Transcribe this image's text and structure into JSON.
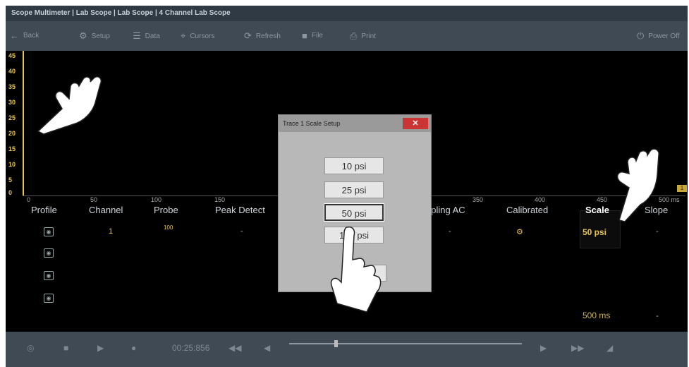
{
  "window": {
    "title": "Scope Multimeter | Lab Scope | Lab Scope | 4 Channel Lab Scope"
  },
  "toolbar": {
    "back": "Back",
    "setup": "Setup",
    "data": "Data",
    "cursors": "Cursors",
    "refresh": "Refresh",
    "file": "File",
    "print": "Print",
    "power_off": "Power Off"
  },
  "plot": {
    "y_ticks": [
      "45",
      "40",
      "35",
      "30",
      "25",
      "20",
      "15",
      "10",
      "5",
      "0"
    ],
    "x_ticks": [
      "0",
      "50",
      "100",
      "150",
      "350",
      "400",
      "450",
      "500 ms"
    ],
    "trace_marker": "1"
  },
  "table": {
    "headers": {
      "profile": "Profile",
      "channel": "Channel",
      "probe": "Probe",
      "peak_detect": "Peak Detect",
      "coupling": "upling AC",
      "calibrated": "Calibrated",
      "scale": "Scale",
      "slope": "Slope"
    },
    "row1": {
      "channel": "1",
      "probe": "100",
      "peak_detect": "-",
      "coupling": "-",
      "scale": "50 psi",
      "slope": "-"
    },
    "time_value": "500 ms",
    "time_slope": "-"
  },
  "dialog": {
    "title": "Trace 1 Scale Setup",
    "close": "✕",
    "options": [
      "10 psi",
      "25 psi",
      "50 psi",
      "100 psi"
    ],
    "selected": "50 psi"
  },
  "status": {
    "time": "00:25:856"
  },
  "colors": {
    "accent": "#e8c64a",
    "toolbar": "#3f4a54",
    "dialog": "#b8b8b8"
  }
}
